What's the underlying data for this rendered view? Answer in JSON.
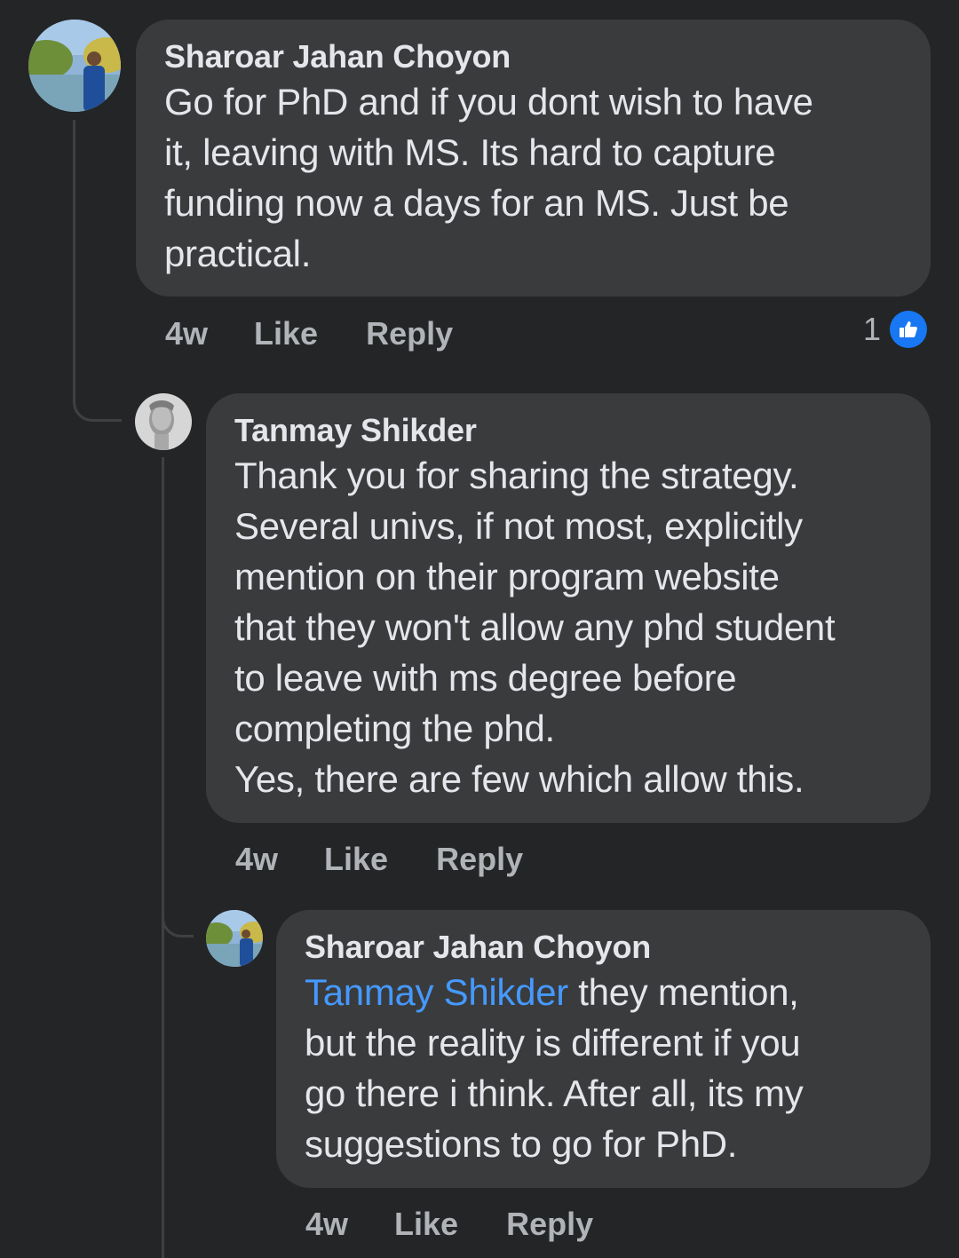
{
  "comments": [
    {
      "author": "Sharoar Jahan Choyon",
      "lines": [
        "Go for PhD and if you dont wish to have",
        "it, leaving with MS. Its hard to capture",
        "funding now a days for an MS. Just be",
        "practical."
      ],
      "time": "4w",
      "like_label": "Like",
      "reply_label": "Reply",
      "reaction_count": "1"
    },
    {
      "author": "Tanmay Shikder",
      "lines": [
        "Thank you for sharing the strategy.",
        "Several univs, if not most, explicitly",
        "mention on their program website",
        "that they won't allow any phd student",
        "to leave with ms degree before",
        "completing the phd.",
        "Yes, there are few which allow this."
      ],
      "time": "4w",
      "like_label": "Like",
      "reply_label": "Reply"
    },
    {
      "author": "Sharoar Jahan Choyon",
      "mention": "Tanmay Shikder",
      "first_line_rest": " they mention,",
      "lines": [
        "but the reality is different if you",
        "go there i think. After all, its my",
        "suggestions to go for PhD."
      ],
      "time": "4w",
      "like_label": "Like",
      "reply_label": "Reply"
    }
  ],
  "icons": {
    "reaction": "thumbs-up-icon"
  },
  "colors": {
    "background": "#242526",
    "bubble": "#3a3b3c",
    "mention": "#4599ff",
    "like_badge": "#1877f2"
  }
}
